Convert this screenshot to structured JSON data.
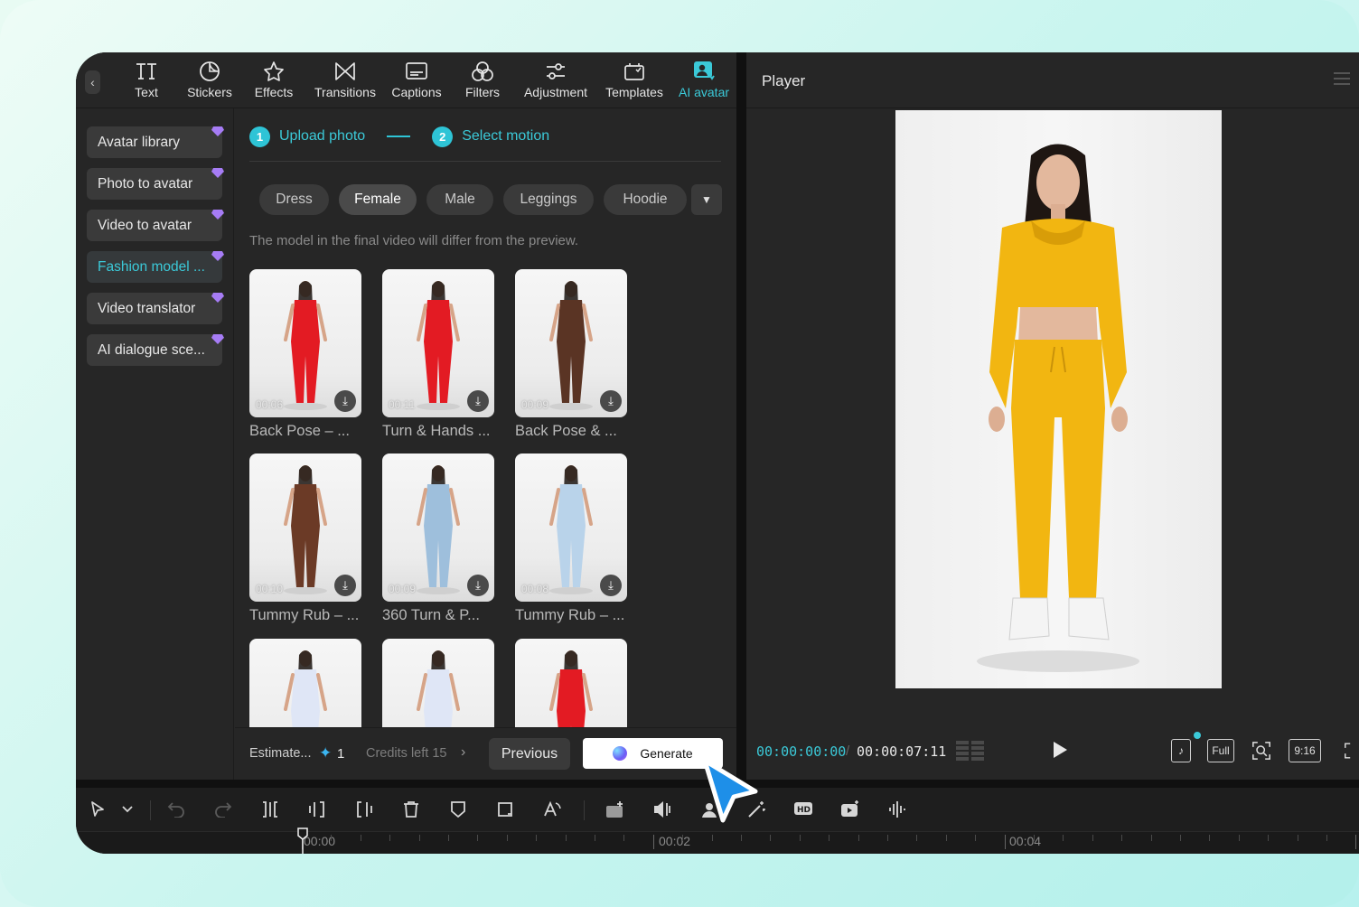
{
  "toolbar": {
    "items": [
      {
        "label": "Text",
        "icon": "text-icon"
      },
      {
        "label": "Stickers",
        "icon": "stickers-icon"
      },
      {
        "label": "Effects",
        "icon": "effects-icon"
      },
      {
        "label": "Transitions",
        "icon": "transitions-icon"
      },
      {
        "label": "Captions",
        "icon": "captions-icon"
      },
      {
        "label": "Filters",
        "icon": "filters-icon"
      },
      {
        "label": "Adjustment",
        "icon": "adjustment-icon"
      },
      {
        "label": "Templates",
        "icon": "templates-icon"
      },
      {
        "label": "AI avatar",
        "icon": "ai-avatar-icon",
        "active": true
      }
    ],
    "accent": "#3bc9d8"
  },
  "sidebar": {
    "items": [
      {
        "label": "Avatar library"
      },
      {
        "label": "Photo to avatar"
      },
      {
        "label": "Video to avatar"
      },
      {
        "label": "Fashion model ...",
        "active": true
      },
      {
        "label": "Video translator"
      },
      {
        "label": "AI dialogue sce..."
      }
    ]
  },
  "steps": [
    {
      "num": "1",
      "label": "Upload photo"
    },
    {
      "num": "2",
      "label": "Select motion"
    }
  ],
  "filters": {
    "chips": [
      "Dress",
      "Female",
      "Male",
      "Leggings",
      "Hoodie"
    ],
    "active": "Female"
  },
  "note": "The model in the final video will differ from the preview.",
  "motions": [
    {
      "duration": "00:06",
      "caption": "Back Pose – ...",
      "outfit": "#e31b23"
    },
    {
      "duration": "00:11",
      "caption": "Turn & Hands ...",
      "outfit": "#e31b23"
    },
    {
      "duration": "00:09",
      "caption": "Back Pose & ...",
      "outfit": "#5a3424"
    },
    {
      "duration": "00:10",
      "caption": "Tummy Rub – ...",
      "outfit": "#6b3a26"
    },
    {
      "duration": "00:09",
      "caption": "360 Turn & P...",
      "outfit": "#9ebfdc"
    },
    {
      "duration": "00:08",
      "caption": "Tummy Rub – ...",
      "outfit": "#b9d3ea"
    },
    {
      "duration": "",
      "caption": "",
      "outfit": "#dfe6f6"
    },
    {
      "duration": "",
      "caption": "",
      "outfit": "#dfe6f6"
    },
    {
      "duration": "",
      "caption": "",
      "outfit": "#e31b23"
    }
  ],
  "footer": {
    "estimate": "Estimate...",
    "estimate_value": "1",
    "credits": "Credits left 15",
    "previous": "Previous",
    "generate": "Generate"
  },
  "player": {
    "title": "Player",
    "time_current": "00:00:00:00",
    "time_separator": "/",
    "time_total": "00:00:07:11",
    "controls": [
      "Full",
      "9:16"
    ]
  },
  "timeline": {
    "ruler_labels": [
      "00:00",
      "00:02",
      "00:04"
    ]
  }
}
